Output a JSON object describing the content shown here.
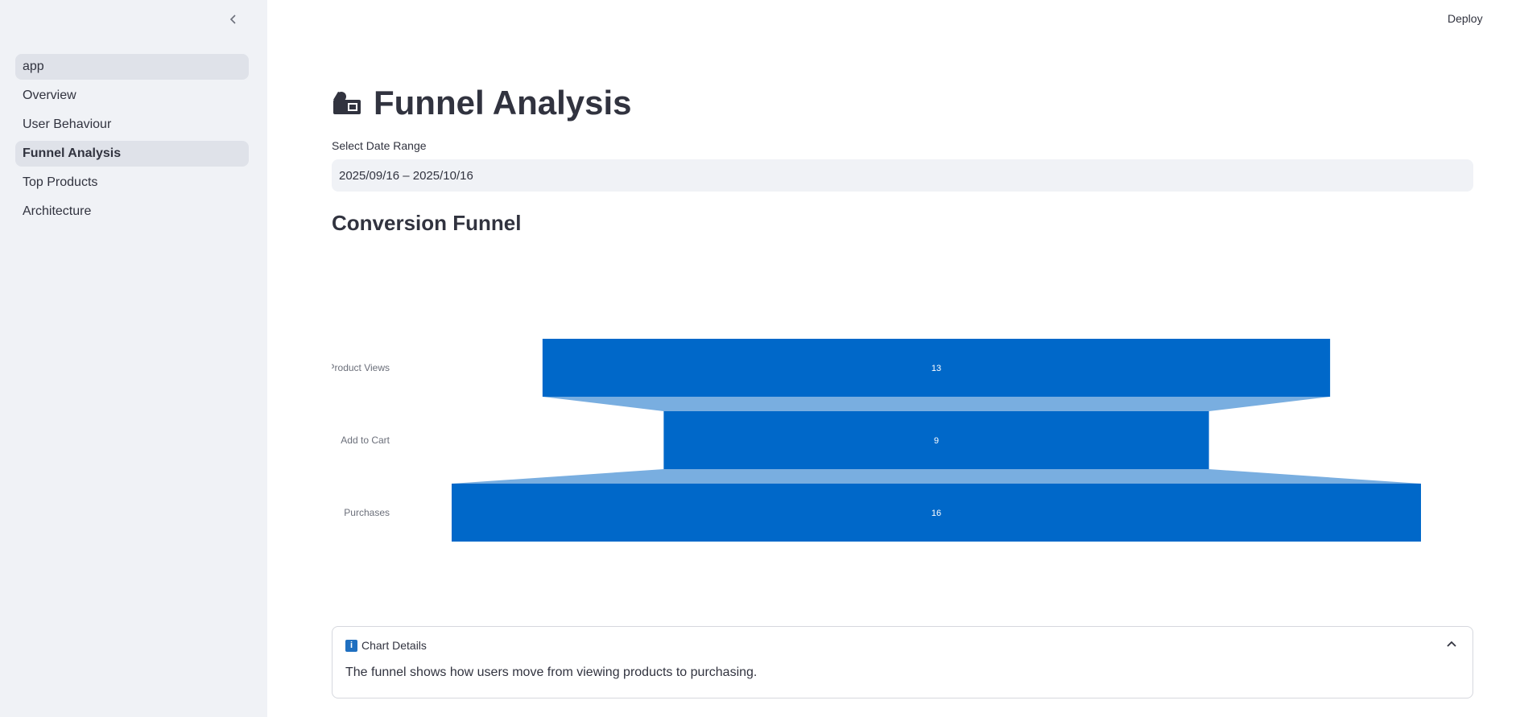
{
  "sidebar": {
    "items": [
      {
        "label": "app"
      },
      {
        "label": "Overview"
      },
      {
        "label": "User Behaviour"
      },
      {
        "label": "Funnel Analysis"
      },
      {
        "label": "Top Products"
      },
      {
        "label": "Architecture"
      }
    ],
    "active_index": 3
  },
  "topbar": {
    "deploy_label": "Deploy"
  },
  "page": {
    "title": "Funnel Analysis",
    "title_icon": "film-clapper-icon",
    "date_label": "Select Date Range",
    "date_value": "2025/09/16 – 2025/10/16",
    "section_title": "Conversion Funnel"
  },
  "chart_data": {
    "type": "funnel",
    "categories": [
      "Product Views",
      "Add to Cart",
      "Purchases"
    ],
    "values": [
      13,
      9,
      16
    ],
    "bar_color": "#0068c9",
    "connector_color": "#79aee0"
  },
  "details": {
    "title": "Chart Details",
    "icon": "info-icon",
    "text": "The funnel shows how users move from viewing products to purchasing."
  }
}
